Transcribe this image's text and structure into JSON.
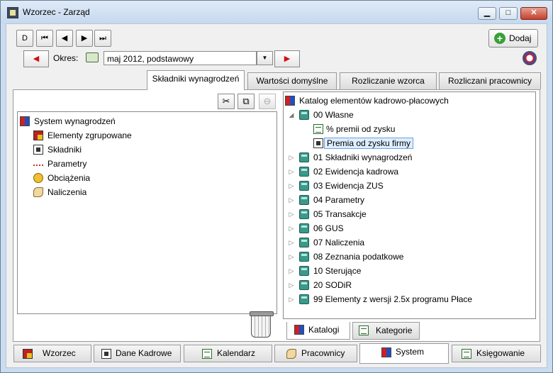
{
  "window": {
    "title": "Wzorzec - Zarząd"
  },
  "toolbar": {
    "first_label": "D",
    "prev_period": "◀",
    "next_period": "▶",
    "add_label": "Dodaj",
    "okres_label": "Okres:",
    "period_value": "maj 2012, podstawowy"
  },
  "top_tabs": [
    {
      "label": "Składniki wynagrodzeń",
      "active": true
    },
    {
      "label": "Wartości domyślne",
      "active": false
    },
    {
      "label": "Rozliczanie wzorca",
      "active": false
    },
    {
      "label": "Rozliczani pracownicy",
      "active": false
    }
  ],
  "left_tree": {
    "root": "System wynagrodzeń",
    "items": [
      {
        "label": "Elementy zgrupowane",
        "icon": "grouped-icon"
      },
      {
        "label": "Składniki",
        "icon": "components-icon"
      },
      {
        "label": "Parametry",
        "icon": "parameters-icon"
      },
      {
        "label": "Obciążenia",
        "icon": "loads-icon"
      },
      {
        "label": "Naliczenia",
        "icon": "accruals-icon"
      }
    ]
  },
  "right_tree": {
    "root": "Katalog elementów kadrowo-płacowych",
    "own_folder": "00 Własne",
    "own_children": [
      {
        "label": "% premii od zysku",
        "icon": "document-icon",
        "selected": false
      },
      {
        "label": "Premia od zysku firmy",
        "icon": "calculator-icon",
        "selected": true
      }
    ],
    "folders": [
      {
        "label": "01 Składniki wynagrodzeń"
      },
      {
        "label": "02 Ewidencja kadrowa"
      },
      {
        "label": "03 Ewidencja ZUS"
      },
      {
        "label": "04 Parametry"
      },
      {
        "label": "05 Transakcje"
      },
      {
        "label": "06 GUS"
      },
      {
        "label": "07 Naliczenia"
      },
      {
        "label": "08 Zeznania podatkowe"
      },
      {
        "label": "10 Sterujące"
      },
      {
        "label": "20 SODiR"
      },
      {
        "label": "99 Elementy z wersji 2.5x programu Płace"
      }
    ]
  },
  "inner_tabs": [
    {
      "label": "Katalogi",
      "active": true
    },
    {
      "label": "Kategorie",
      "active": false
    }
  ],
  "bottom_tabs": [
    {
      "label": "Wzorzec",
      "active": false
    },
    {
      "label": "Dane Kadrowe",
      "active": false
    },
    {
      "label": "Kalendarz",
      "active": false
    },
    {
      "label": "Pracownicy",
      "active": false
    },
    {
      "label": "System",
      "active": true
    },
    {
      "label": "Księgowanie",
      "active": false
    }
  ],
  "colors": {
    "accent": "#d01010",
    "selection": "#ddeeff",
    "chrome": "#c9dcf0"
  }
}
